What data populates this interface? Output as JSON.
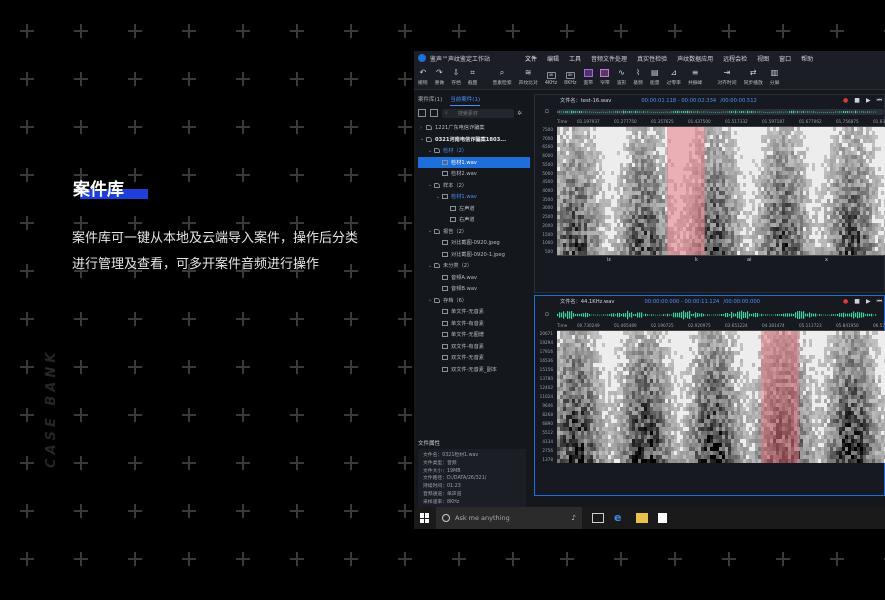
{
  "hero": {
    "title": "案件库",
    "description": "案件库可一键从本地及云端导入案件，操作后分类进行管理及查看，可多开案件音频进行操作",
    "vertical_brand": "CASE BANK"
  },
  "app": {
    "title": "鉴声™声纹鉴定工作站",
    "menu": [
      "文件",
      "编辑",
      "工具",
      "音频文件处理",
      "真实性检验",
      "声纹数据应用",
      "远程会检",
      "视图",
      "窗口",
      "帮助"
    ],
    "toolbar": [
      {
        "icon": "undo-icon",
        "label": "撤销"
      },
      {
        "icon": "redo-icon",
        "label": "重做"
      },
      {
        "icon": "save-icon",
        "label": "存档"
      },
      {
        "icon": "crop-icon",
        "label": "截图"
      },
      {
        "icon": "search-icon",
        "label": "音素检索"
      },
      {
        "icon": "waveform-icon",
        "label": "声纹比对"
      },
      {
        "icon": "4k-icon",
        "label": "4KHz"
      },
      {
        "icon": "8k-icon",
        "label": "8KHz"
      },
      {
        "icon": "wide-band-icon",
        "label": "宽带"
      },
      {
        "icon": "narrow-band-icon",
        "label": "窄带"
      },
      {
        "icon": "wave-view-icon",
        "label": "波形"
      },
      {
        "icon": "base-freq-icon",
        "label": "基频"
      },
      {
        "icon": "energy-icon",
        "label": "能量"
      },
      {
        "icon": "zero-cross-icon",
        "label": "过零率"
      },
      {
        "icon": "formant-icon",
        "label": "共振峰"
      },
      {
        "icon": "align-time-icon",
        "label": "对齐时间"
      },
      {
        "icon": "sync-play-icon",
        "label": "同步播放"
      },
      {
        "icon": "split-icon",
        "label": "分屏"
      }
    ],
    "tabs": [
      "案件库(1)",
      "当前案件(1)"
    ],
    "search_placeholder": "搜索素材",
    "tree": [
      {
        "label": "1221广东电信诈骗案",
        "depth": 0,
        "kind": "folder",
        "caret": "›",
        "style": ""
      },
      {
        "label": "0321河南电信诈骗案1803...",
        "depth": 0,
        "kind": "folder",
        "caret": "⌄",
        "style": "bold"
      },
      {
        "label": "检材（2）",
        "depth": 1,
        "kind": "folder",
        "caret": "⌄",
        "style": "blue"
      },
      {
        "label": "检材1.wav",
        "depth": 2,
        "kind": "file",
        "caret": "",
        "style": "sel"
      },
      {
        "label": "检材2.wav",
        "depth": 2,
        "kind": "file",
        "caret": "",
        "style": ""
      },
      {
        "label": "样本（2）",
        "depth": 1,
        "kind": "folder",
        "caret": "⌄",
        "style": ""
      },
      {
        "label": "检材1.wav",
        "depth": 2,
        "kind": "file",
        "caret": "⌄",
        "style": "blue"
      },
      {
        "label": "左声道",
        "depth": 3,
        "kind": "file",
        "caret": "",
        "style": ""
      },
      {
        "label": "右声道",
        "depth": 3,
        "kind": "file",
        "caret": "",
        "style": ""
      },
      {
        "label": "报告（2）",
        "depth": 1,
        "kind": "folder",
        "caret": "⌄",
        "style": ""
      },
      {
        "label": "对比截图-0920.jpeg",
        "depth": 2,
        "kind": "file",
        "caret": "",
        "style": ""
      },
      {
        "label": "对比截图-0920-1.jpeg",
        "depth": 2,
        "kind": "file",
        "caret": "",
        "style": ""
      },
      {
        "label": "未分类（2）",
        "depth": 1,
        "kind": "folder",
        "caret": "⌄",
        "style": ""
      },
      {
        "label": "音频A.wav",
        "depth": 2,
        "kind": "file",
        "caret": "",
        "style": ""
      },
      {
        "label": "音频B.wav",
        "depth": 2,
        "kind": "file",
        "caret": "",
        "style": ""
      },
      {
        "label": "存档（6）",
        "depth": 1,
        "kind": "folder",
        "caret": "⌄",
        "style": ""
      },
      {
        "label": "单文件-无音素",
        "depth": 2,
        "kind": "file",
        "caret": "",
        "style": ""
      },
      {
        "label": "单文件-有音素",
        "depth": 2,
        "kind": "file",
        "caret": "",
        "style": ""
      },
      {
        "label": "单文件-无图谱",
        "depth": 2,
        "kind": "file",
        "caret": "",
        "style": ""
      },
      {
        "label": "双文件-有音素",
        "depth": 2,
        "kind": "file",
        "caret": "",
        "style": ""
      },
      {
        "label": "双文件-无音素",
        "depth": 2,
        "kind": "file",
        "caret": "",
        "style": ""
      },
      {
        "label": "双文件-无音素_副本",
        "depth": 2,
        "kind": "file",
        "caret": "",
        "style": ""
      }
    ],
    "props_title": "文件属性",
    "props": [
      "文件名：0321检材1.wav",
      "文件类型：音频",
      "文件大小：19MB",
      "文件路径：D:/DATA/26/321/",
      "持续时间：01:23",
      "音频通道：单声道",
      "采样速率：8KHz",
      "采样精度：16bit",
      "编码格式：pcm",
      "比特率：128kbps"
    ],
    "track1": {
      "file_label": "文件名：test-16.wav",
      "time": "00:00:01.118 - 00:00:02.334",
      "total": "/00:00:00.512",
      "overview_label": "Ω",
      "ruler_unit": "Time",
      "ruler": [
        "01.197937",
        "01.277750",
        "01.357625",
        "01.437500",
        "01.517332",
        "01.597187",
        "01.677062",
        "01.756875",
        "01.836750"
      ],
      "yticks": [
        "7500",
        "7000",
        "6500",
        "6000",
        "5500",
        "5000",
        "4500",
        "4000",
        "3500",
        "3000",
        "2500",
        "2000",
        "1500",
        "1000",
        "500"
      ],
      "segments": [
        "iɛ",
        "k",
        "ai",
        "x"
      ]
    },
    "track2": {
      "file_label": "文件名：44.1KHz.wav",
      "time": "00:00:00.000 - 00:00:11.124",
      "total": "/00:00:00.000",
      "overview_label": "Ω",
      "ruler_unit": "Time",
      "ruler": [
        "00.730249",
        "01.465489",
        "02.190725",
        "02.920975",
        "03.651224",
        "04.381474",
        "05.111723",
        "05.841950",
        "06.572200"
      ],
      "yticks": [
        "20671",
        "19294",
        "17916",
        "16536",
        "15156",
        "13780",
        "12402",
        "11024",
        "9646",
        "8268",
        "6890",
        "5512",
        "4134",
        "2756",
        "1378"
      ]
    }
  },
  "taskbar": {
    "search_placeholder": "Ask me anything"
  },
  "colors": {
    "accent": "#1e6fd9",
    "hero_underline": "#1e3fd9",
    "selection": "#e87a86",
    "wave": "#3fd6a0",
    "record": "#e03a3a"
  }
}
